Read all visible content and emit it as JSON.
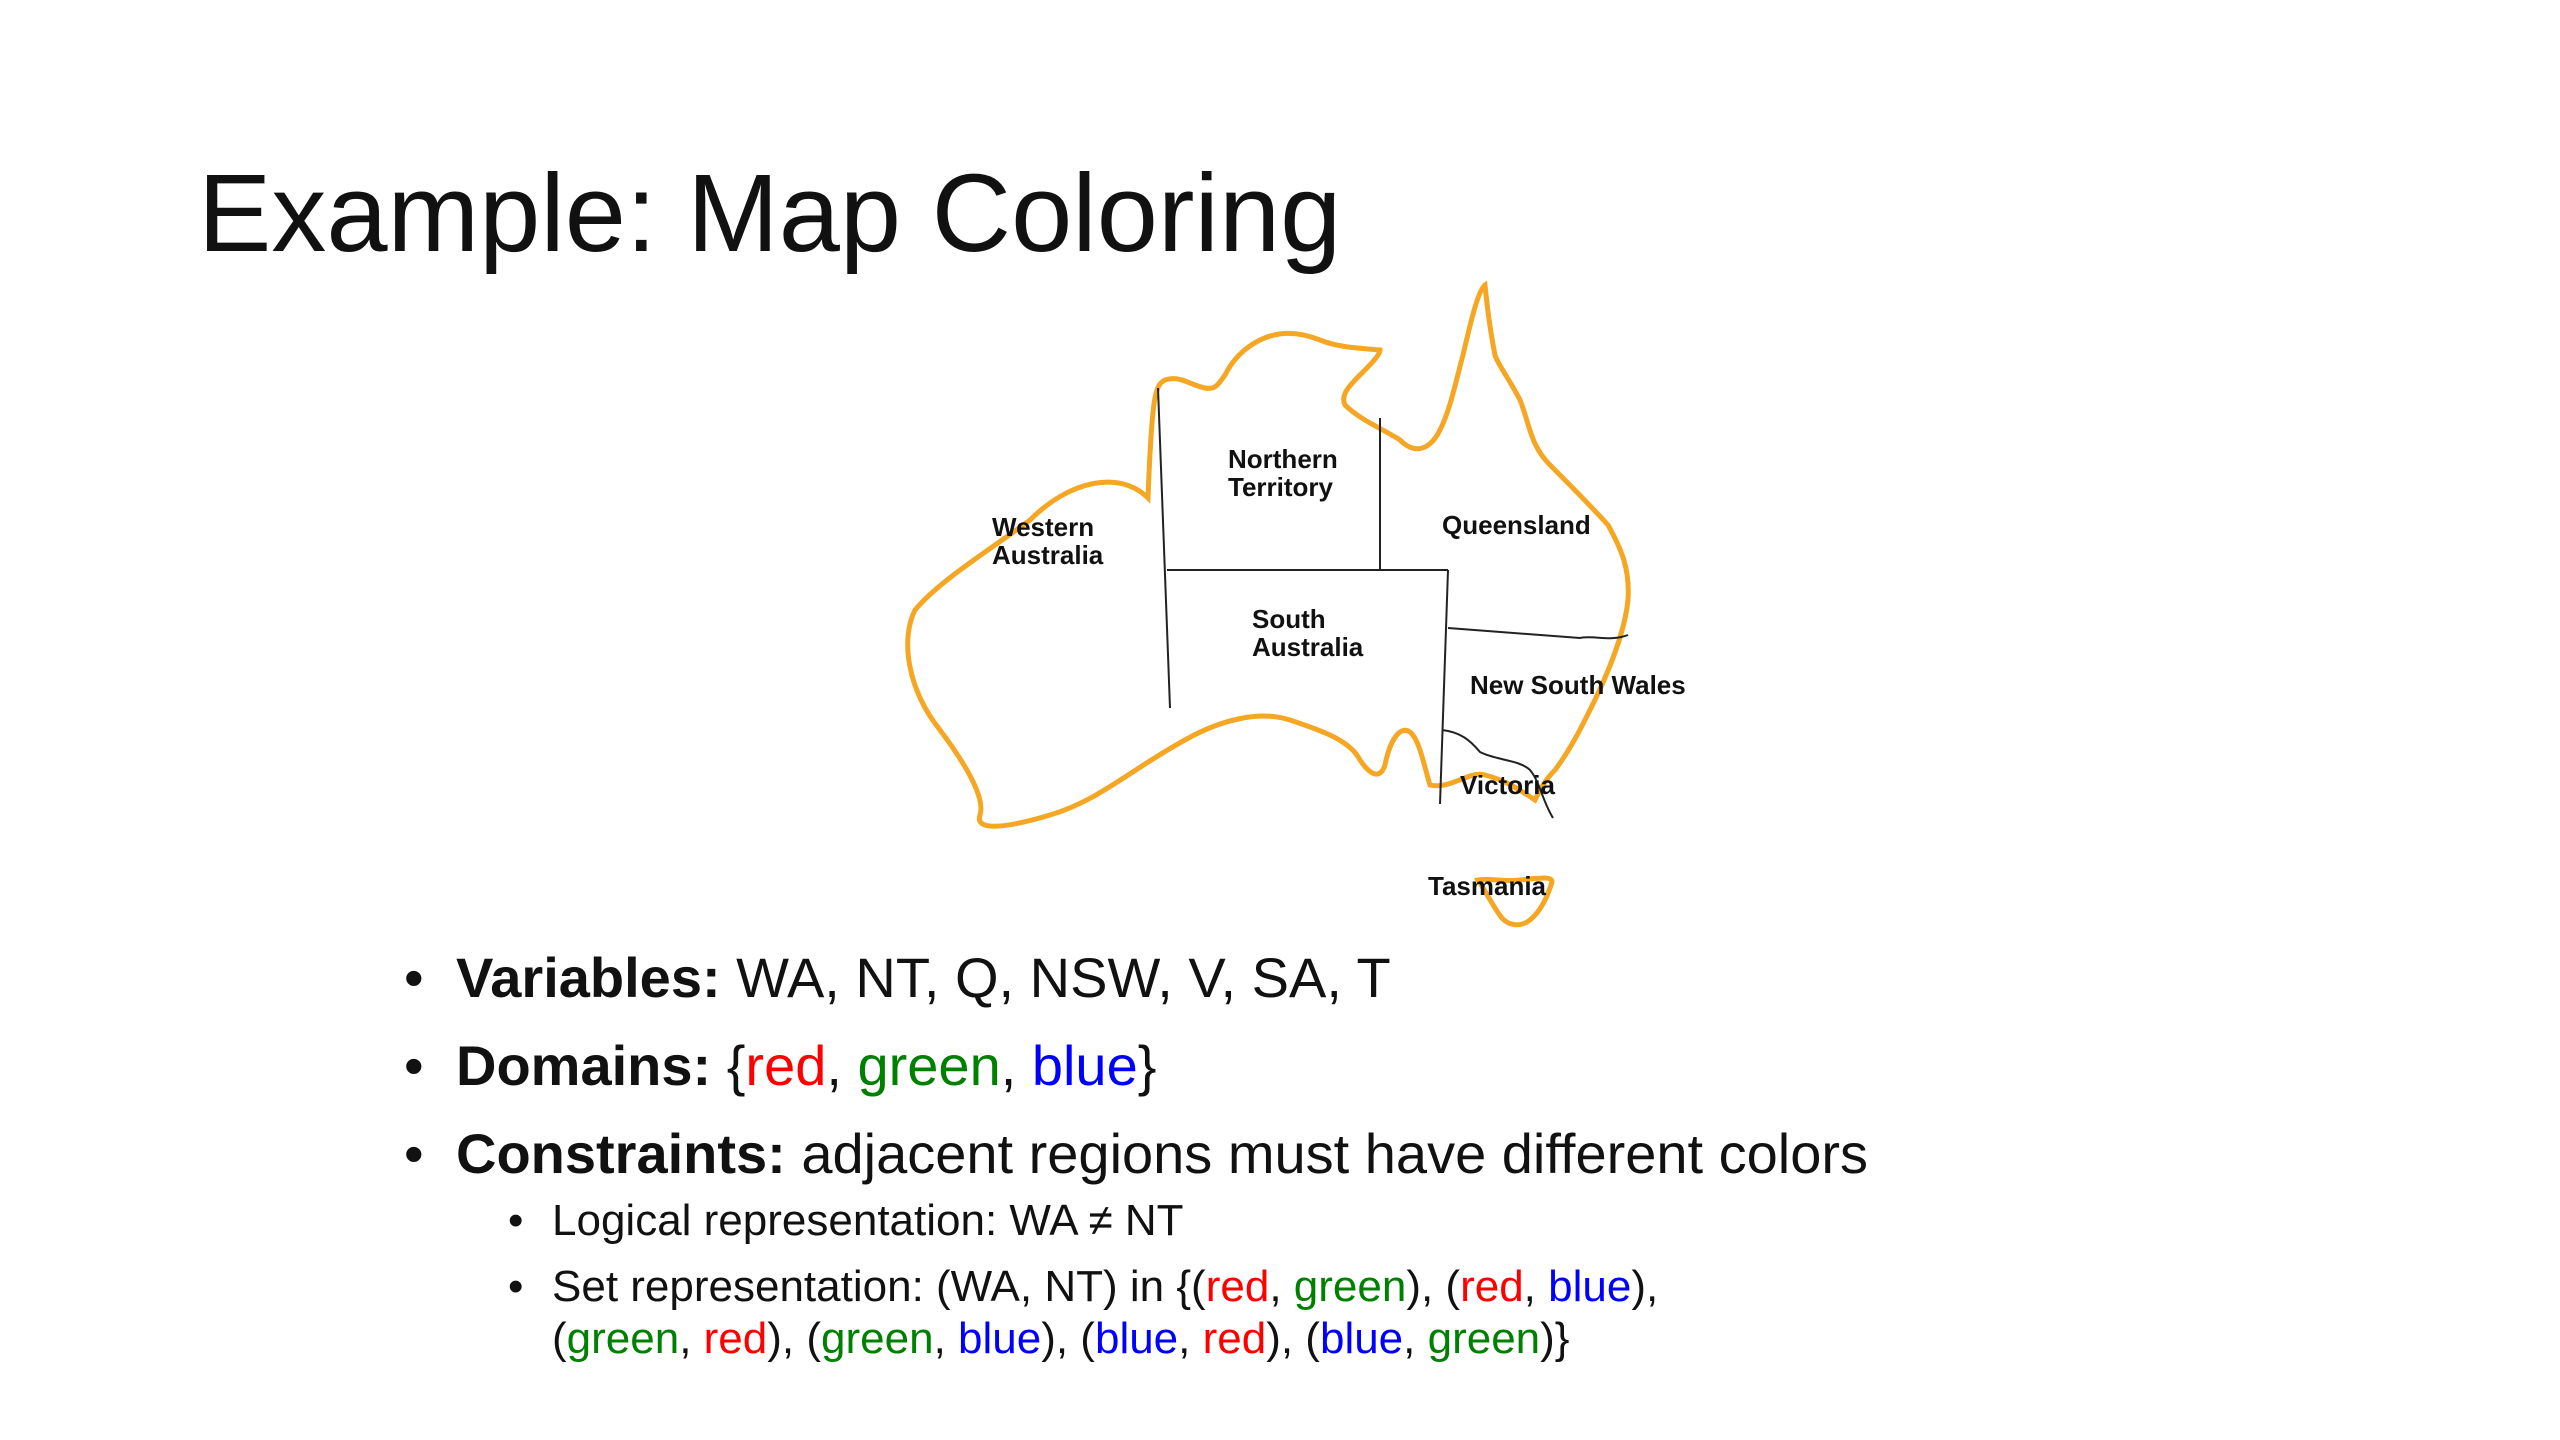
{
  "slide": {
    "title": "Example: Map Coloring"
  },
  "map": {
    "outline_color": "#f5a623",
    "border_color": "#222222",
    "labels": {
      "wa_line1": "Western",
      "wa_line2": "Australia",
      "nt_line1": "Northern",
      "nt_line2": "Territory",
      "q": "Queensland",
      "sa_line1": "South",
      "sa_line2": "Australia",
      "nsw": "New South Wales",
      "v": "Victoria",
      "t": "Tasmania"
    }
  },
  "bullets": {
    "variables": {
      "lead": "Variables:",
      "text": " WA, NT, Q, NSW, V, SA, T"
    },
    "domains": {
      "lead": "Domains:",
      "open": " {",
      "red": "red",
      "sep1": ", ",
      "green": "green",
      "sep2": ", ",
      "blue": "blue",
      "close": "}"
    },
    "constraints": {
      "lead": "Constraints:",
      "text": " adjacent regions must have different colors"
    }
  },
  "sub_bullets": {
    "logical": "Logical representation: WA ≠ NT",
    "set": {
      "prefix": "Set representation: (WA, NT) in {(",
      "p1a": "red",
      "s1": ", ",
      "p1b": "green",
      "c1": "), (",
      "p2a": "red",
      "s2": ", ",
      "p2b": "blue",
      "c2": "),",
      "line2_open": "(",
      "p3a": "green",
      "s3": ", ",
      "p3b": "red",
      "c3": "), (",
      "p4a": "green",
      "s4": ", ",
      "p4b": "blue",
      "c4": "), (",
      "p5a": "blue",
      "s5": ", ",
      "p5b": "red",
      "c5": "), (",
      "p6a": "blue",
      "s6": ", ",
      "p6b": "green",
      "c6": ")}"
    }
  },
  "colors": {
    "red": "#ff0000",
    "green": "#008000",
    "blue": "#0000ff"
  }
}
